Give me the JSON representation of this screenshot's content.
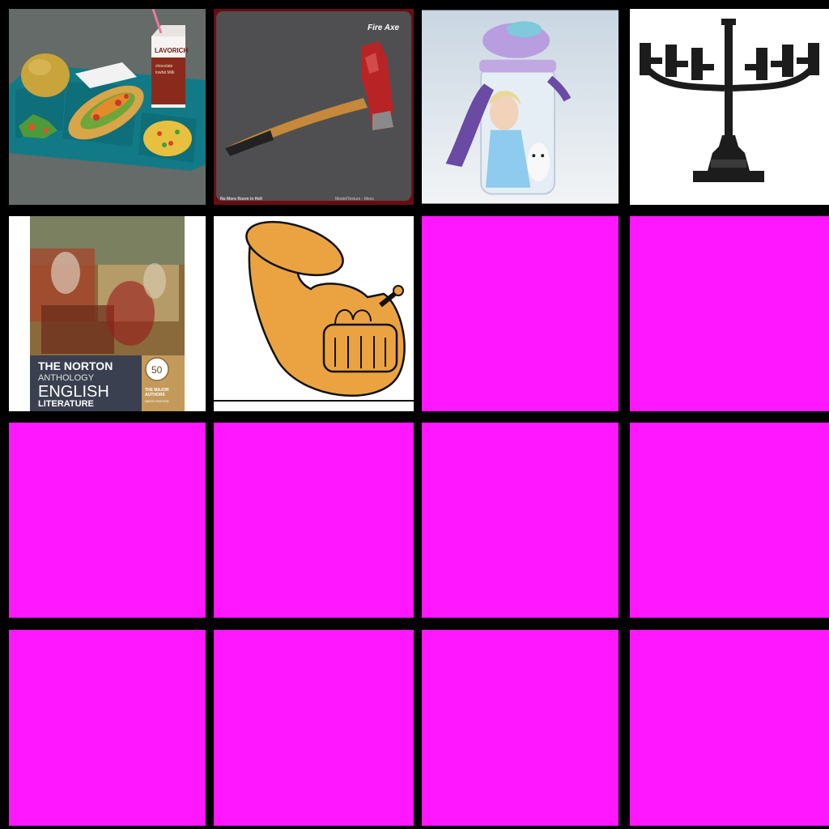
{
  "grid": {
    "rows": 4,
    "columns": 4,
    "background_color": "#000000",
    "placeholder_color": "#ff17ff",
    "tiles": [
      {
        "subject": "school lunch tray"
      },
      {
        "subject": "fire axe"
      },
      {
        "subject": "frozen water bottle"
      },
      {
        "subject": "menorah"
      },
      {
        "subject": "book cover"
      },
      {
        "subject": "tuba drawing"
      },
      {
        "subject": "placeholder"
      },
      {
        "subject": "placeholder"
      },
      {
        "subject": "placeholder"
      },
      {
        "subject": "placeholder"
      },
      {
        "subject": "placeholder"
      },
      {
        "subject": "placeholder"
      },
      {
        "subject": "placeholder"
      },
      {
        "subject": "placeholder"
      },
      {
        "subject": "placeholder"
      },
      {
        "subject": "placeholder"
      }
    ]
  },
  "fire_axe": {
    "caption": "Fire Axe",
    "footer_left": "No More Room In Hell",
    "footer_right": "Model/Texture - Mexx"
  },
  "lunch": {
    "milk_brand": "LAVORICH",
    "milk_line1": "chocolate",
    "milk_line2": "lowfat Milk"
  },
  "book": {
    "title_line1": "THE NORTON",
    "title_line2": "ANTHOLOGY",
    "title_line3": "ENGLISH",
    "title_line4": "LITERATURE",
    "badge_number": "50",
    "subtitle_line1": "THE MAJOR",
    "subtitle_line2": "AUTHORS",
    "edition": "NINTH EDITION"
  }
}
